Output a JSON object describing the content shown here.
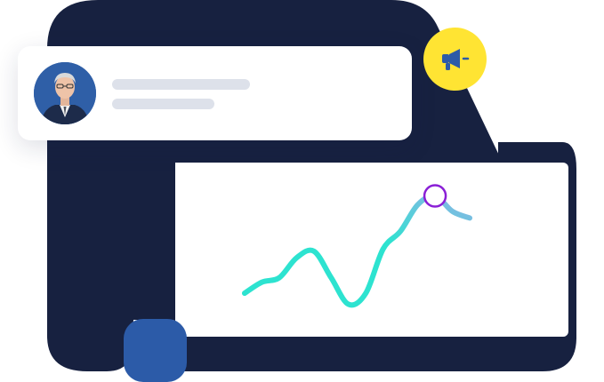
{
  "colors": {
    "navy_panel": "#172140",
    "accent_yellow": "#ffe433",
    "accent_blue": "#2c5ba8",
    "placeholder_gray": "#dde1ea",
    "line_start": "#2de3d0",
    "line_end": "#8fb3e6",
    "marker": "#8a1fd6"
  },
  "profile_card": {
    "avatar_icon": "person-photo",
    "placeholder_lines": 2
  },
  "badge": {
    "icon": "megaphone-icon"
  },
  "chart_data": {
    "type": "line",
    "series": [
      {
        "values": [
          [
            0,
            8
          ],
          [
            1,
            13
          ],
          [
            2,
            15
          ],
          [
            3,
            24
          ],
          [
            4,
            27
          ],
          [
            5,
            15
          ],
          [
            6,
            3
          ],
          [
            7,
            8
          ],
          [
            8,
            28
          ],
          [
            9,
            36
          ],
          [
            10,
            48
          ],
          [
            11,
            52
          ],
          [
            12,
            45
          ],
          [
            13,
            42
          ]
        ]
      }
    ],
    "highlight_point": [
      11,
      52
    ],
    "xlim": [
      0,
      13
    ],
    "ylim": [
      0,
      55
    ],
    "grid": false,
    "legend": "none"
  }
}
